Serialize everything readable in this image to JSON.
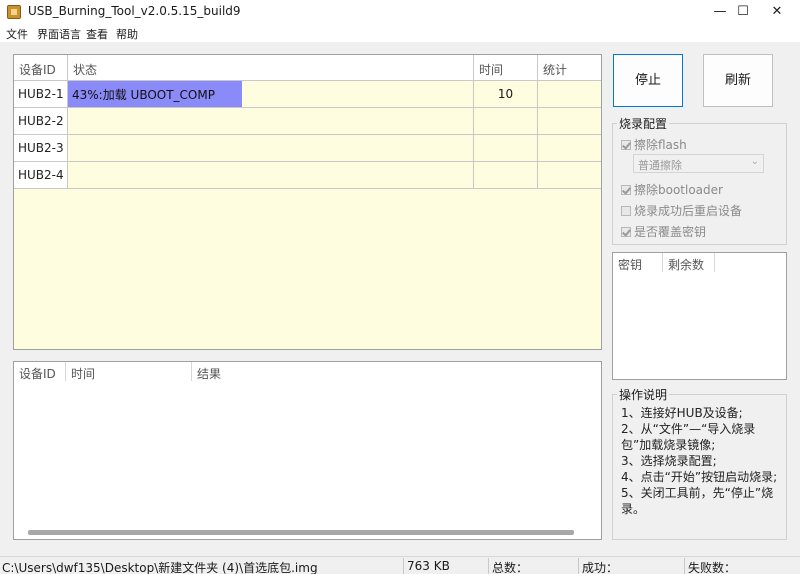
{
  "window": {
    "title": "USB_Burning_Tool_v2.0.5.15_build9",
    "min_glyph": "—",
    "max_glyph": "☐",
    "close_glyph": "✕"
  },
  "menu": [
    "文件",
    "界面语言",
    "查看",
    "帮助"
  ],
  "device_table": {
    "headers": [
      "设备ID",
      "状态",
      "时间",
      "统计"
    ],
    "rows": [
      {
        "id": "HUB2-1",
        "status": "43%:加载 UBOOT_COMP",
        "progress_percent": 43,
        "time": "10",
        "stat": ""
      },
      {
        "id": "HUB2-2",
        "status": "",
        "time": "",
        "stat": ""
      },
      {
        "id": "HUB2-3",
        "status": "",
        "time": "",
        "stat": ""
      },
      {
        "id": "HUB2-4",
        "status": "",
        "time": "",
        "stat": ""
      }
    ]
  },
  "log_table": {
    "headers": [
      "设备ID",
      "时间",
      "结果"
    ]
  },
  "buttons": {
    "stop": "停止",
    "refresh": "刷新"
  },
  "burn_config": {
    "title": "烧录配置",
    "erase_flash": {
      "label": "擦除flash",
      "checked": true
    },
    "erase_mode": "普通擦除",
    "erase_bootloader": {
      "label": "擦除bootloader",
      "checked": true
    },
    "reboot_after": {
      "label": "烧录成功后重启设备",
      "checked": false
    },
    "overwrite_key": {
      "label": "是否覆盖密钥",
      "checked": true
    }
  },
  "key_table": {
    "headers": [
      "密钥",
      "剩余数"
    ]
  },
  "instructions": {
    "title": "操作说明",
    "lines": [
      "1、连接好HUB及设备;",
      "2、从“文件”—“导入烧录包”加载烧录镜像;",
      "3、选择烧录配置;",
      "4、点击“开始”按钮启动烧录;",
      "5、关闭工具前，先“停止”烧录。"
    ]
  },
  "status_bar": {
    "path": "C:\\Users\\dwf135\\Desktop\\新建文件夹 (4)\\首选底包.img",
    "size": "763 KB",
    "total_label": "总数：",
    "success_label": "成功：",
    "fail_label": "失败数："
  },
  "colors": {
    "grid_bg": "#fffde0",
    "progress": "#8a8af8",
    "accent": "#0078d4"
  }
}
